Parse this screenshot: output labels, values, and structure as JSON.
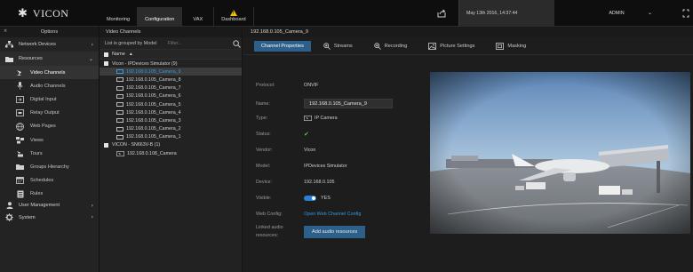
{
  "app": {
    "logo_text": "VICON",
    "nav_tabs": [
      {
        "label": "Monitoring"
      },
      {
        "label": "Configuration"
      },
      {
        "label": "VAX"
      },
      {
        "label": "Dashboard"
      }
    ],
    "datetime": "May 13th 2016, 14:37:44",
    "user": "ADMIN"
  },
  "sidebar": {
    "title": "Options",
    "items": [
      {
        "label": "Network Devices",
        "icon": "network-icon"
      },
      {
        "label": "Resources",
        "icon": "folder-icon"
      }
    ],
    "resources_sub": [
      {
        "label": "Video Channels",
        "icon": "camera-icon"
      },
      {
        "label": "Audio Channels",
        "icon": "microphone-icon"
      },
      {
        "label": "Digital Input",
        "icon": "digital-input-icon"
      },
      {
        "label": "Relay Output",
        "icon": "relay-icon"
      },
      {
        "label": "Web Pages",
        "icon": "globe-icon"
      },
      {
        "label": "Views",
        "icon": "views-icon"
      },
      {
        "label": "Tours",
        "icon": "tours-icon"
      },
      {
        "label": "Groups Hierarchy",
        "icon": "folder-icon"
      },
      {
        "label": "Schedules",
        "icon": "calendar-icon"
      },
      {
        "label": "Rules",
        "icon": "rules-icon"
      }
    ],
    "bottom_items": [
      {
        "label": "User Management",
        "icon": "user-icon"
      },
      {
        "label": "System",
        "icon": "gear-icon"
      }
    ]
  },
  "channels": {
    "title": "Video Channels",
    "grouped_by": "List is grouped by Model",
    "filter_placeholder": "Filter...",
    "column_header": "Name",
    "groups": [
      {
        "name": "Vicon - IPDevices Simulator (9)",
        "cameras": [
          "192.168.0.105_Camera_9",
          "192.168.0.105_Camera_8",
          "192.168.0.105_Camera_7",
          "192.168.0.105_Camera_6",
          "192.168.0.105_Camera_5",
          "192.168.0.105_Camera_4",
          "192.168.0.105_Camera_3",
          "192.168.0.105_Camera_2",
          "192.168.0.105_Camera_1"
        ]
      },
      {
        "name": "VICON - SN663V-B (1)",
        "cameras": [
          "192.168.0.108_Camera"
        ]
      }
    ]
  },
  "main": {
    "camera_title": "192.168.0.105_Camera_9",
    "tabs": [
      {
        "label": "Channel Properties"
      },
      {
        "label": "Streams",
        "icon": "zoom-icon"
      },
      {
        "label": "Recording",
        "icon": "zoom-icon"
      },
      {
        "label": "Picture Settings",
        "icon": "picture-icon"
      },
      {
        "label": "Masking",
        "icon": "mask-icon"
      }
    ],
    "props": {
      "protocol_label": "Protocol:",
      "protocol_value": "ONVIF",
      "name_label": "Name:",
      "name_value": "192.168.0.105_Camera_9",
      "type_label": "Type:",
      "type_value": "IP Camera",
      "status_label": "Status:",
      "vendor_label": "Vendor:",
      "vendor_value": "Vicon",
      "model_label": "Model:",
      "model_value": "IPDevices Simulator",
      "device_label": "Device:",
      "device_value": "192.168.0.105",
      "visible_label": "Visible:",
      "visible_value": "YES",
      "webconfig_label": "Web Config:",
      "webconfig_link": "Open Web Channel Config",
      "linked_audio_label": "Linked audio resources:",
      "add_audio_button": "Add audio resources"
    },
    "colors": {
      "accent": "#2c5f8a",
      "link": "#2f9be8",
      "status_ok": "#5cc14a"
    }
  }
}
